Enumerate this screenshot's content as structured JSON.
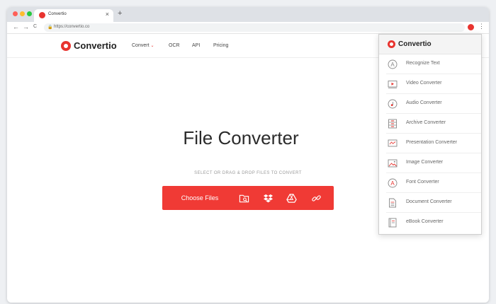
{
  "browser": {
    "tab_title": "Convertio",
    "tab_close": "×",
    "new_tab": "+",
    "back": "←",
    "forward": "→",
    "reload": "C",
    "url": "https://convertio.co",
    "menu_glyph": "⋮",
    "traffic_lights": [
      "#ff5f57",
      "#febc2e",
      "#28c840"
    ]
  },
  "site": {
    "brand": "Convertio",
    "nav": [
      "Convert",
      "OCR",
      "API",
      "Pricing"
    ],
    "nav_chevron": "⌄"
  },
  "hero": {
    "title": "File Converter",
    "subtitle": "SELECT OR DRAG & DROP FILES TO CONVERT",
    "choose_files": "Choose Files",
    "sources": [
      "folder-search-icon",
      "dropbox-icon",
      "google-drive-icon",
      "link-icon"
    ]
  },
  "dropdown": {
    "brand": "Convertio",
    "items": [
      {
        "label": "Recognize Text",
        "icon": "ocr-icon"
      },
      {
        "label": "Video Converter",
        "icon": "video-icon"
      },
      {
        "label": "Audio Converter",
        "icon": "audio-icon"
      },
      {
        "label": "Archive Converter",
        "icon": "archive-icon"
      },
      {
        "label": "Presentation Converter",
        "icon": "presentation-icon"
      },
      {
        "label": "Image Converter",
        "icon": "image-icon"
      },
      {
        "label": "Font Converter",
        "icon": "font-icon"
      },
      {
        "label": "Document Converter",
        "icon": "document-icon"
      },
      {
        "label": "eBook Converter",
        "icon": "ebook-icon"
      }
    ]
  },
  "colors": {
    "accent": "#f03a35",
    "text_dark": "#2b2b2b"
  }
}
